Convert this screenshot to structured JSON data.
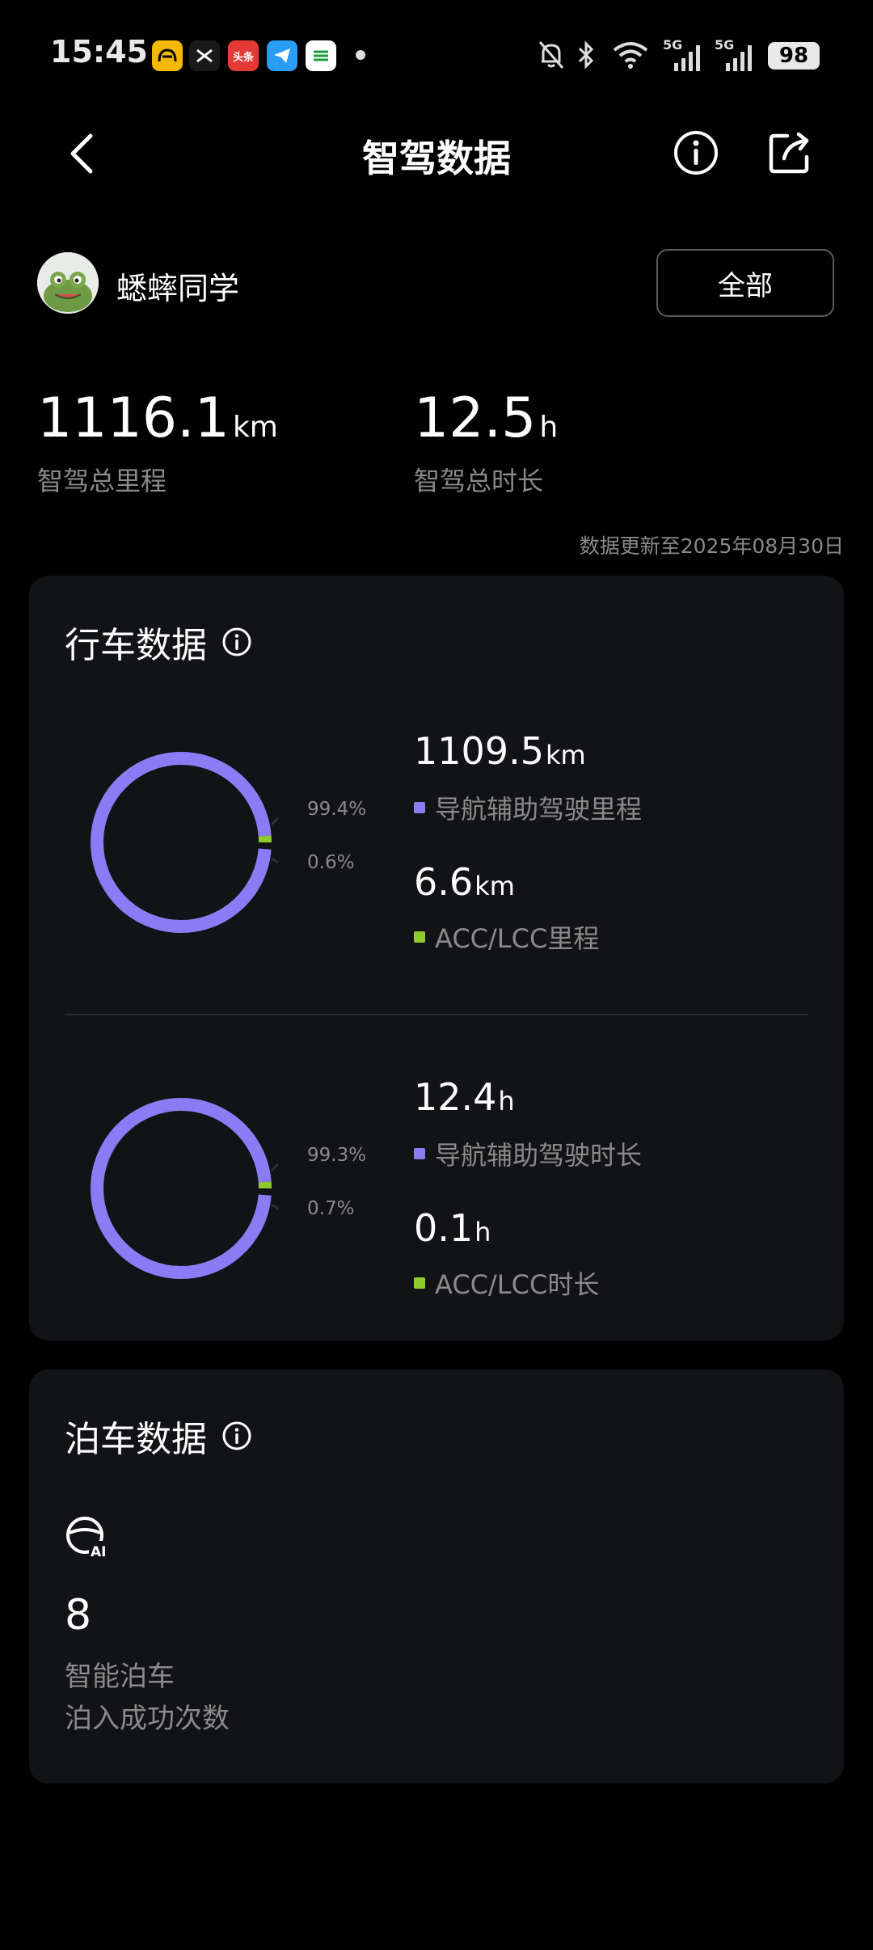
{
  "status_bar": {
    "time": "15:45",
    "battery": "98",
    "network": [
      "5G",
      "5G"
    ]
  },
  "header": {
    "title": "智驾数据"
  },
  "user": {
    "name": "蟋蟀同学",
    "filter_label": "全部"
  },
  "totals": {
    "mileage": {
      "value": "1116.1",
      "unit": "km",
      "label": "智驾总里程"
    },
    "duration": {
      "value": "12.5",
      "unit": "h",
      "label": "智驾总时长"
    },
    "update_text": "数据更新至2025年08月30日"
  },
  "driving": {
    "title": "行车数据",
    "mileage": {
      "nav": {
        "value": "1109.5",
        "unit": "km",
        "label": "导航辅助驾驶里程",
        "pct": "99.4%"
      },
      "acc": {
        "value": "6.6",
        "unit": "km",
        "label": "ACC/LCC里程",
        "pct": "0.6%"
      }
    },
    "duration": {
      "nav": {
        "value": "12.4",
        "unit": "h",
        "label": "导航辅助驾驶时长",
        "pct": "99.3%"
      },
      "acc": {
        "value": "0.1",
        "unit": "h",
        "label": "ACC/LCC时长",
        "pct": "0.7%"
      }
    }
  },
  "parking": {
    "title": "泊车数据",
    "count": "8",
    "label1": "智能泊车",
    "label2": "泊入成功次数"
  },
  "colors": {
    "nav": "#8b7cf6",
    "acc": "#8fcb2a",
    "card": "#121316"
  },
  "chart_data": [
    {
      "type": "pie",
      "categories": [
        "导航辅助驾驶里程",
        "ACC/LCC里程"
      ],
      "values": [
        99.4,
        0.6
      ]
    },
    {
      "type": "pie",
      "categories": [
        "导航辅助驾驶时长",
        "ACC/LCC时长"
      ],
      "values": [
        99.3,
        0.7
      ]
    }
  ]
}
